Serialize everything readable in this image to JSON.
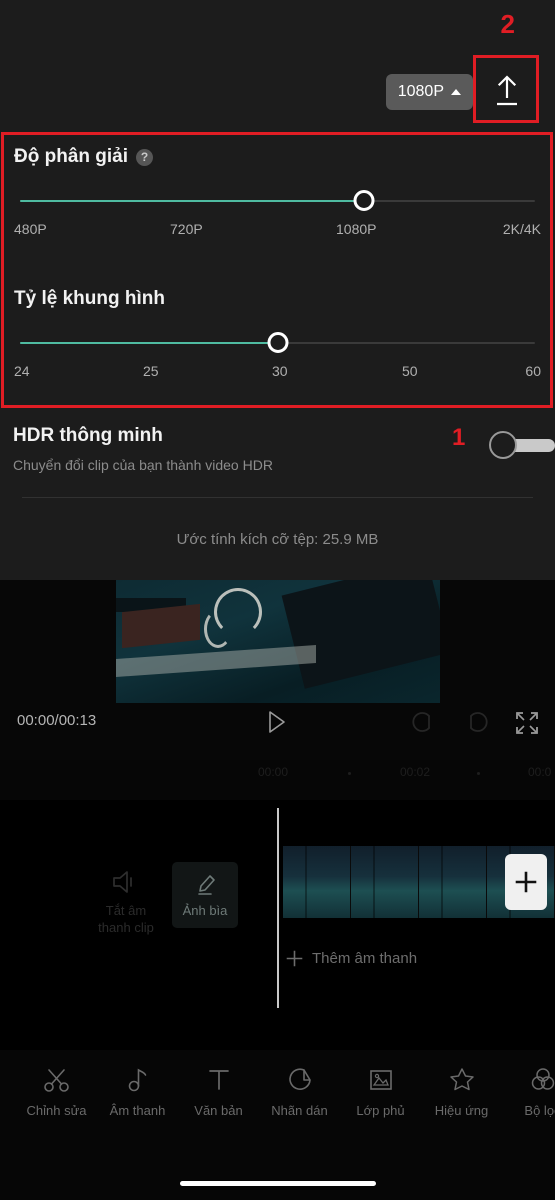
{
  "export_panel": {
    "resolution_chip": {
      "label": "1080P",
      "caret_icon": "chevron-up-icon"
    },
    "export_icon": "export-upload-icon",
    "resolution": {
      "title": "Độ phân giải",
      "help_icon": "?",
      "labels": [
        "480P",
        "720P",
        "1080P",
        "2K/4K"
      ],
      "selected": "1080P",
      "selected_index": 2
    },
    "framerate": {
      "title": "Tỷ lệ khung hình",
      "labels": [
        "24",
        "25",
        "30",
        "50",
        "60"
      ],
      "selected": "30",
      "selected_index": 2
    },
    "hdr": {
      "title": "HDR thông minh",
      "subtitle": "Chuyển đổi clip của bạn thành video HDR",
      "toggle_state": "off"
    },
    "file_size": "Ước tính kích cỡ tệp: 25.9 MB"
  },
  "annotations": {
    "marker_one": "1",
    "marker_two": "2",
    "color": "#e01d24"
  },
  "preview": {
    "time_display": "00:00/00:13",
    "play_icon": "play-icon",
    "undo_icon": "undo-icon",
    "redo_icon": "redo-icon",
    "fullscreen_icon": "fullscreen-icon"
  },
  "timeline": {
    "ruler_labels": [
      "00:00",
      "00:02",
      "00:0"
    ],
    "mute_clip_label": "Tắt âm thanh clip",
    "mute_icon": "speaker-mute-icon",
    "cover_label": "Ảnh bìa",
    "cover_icon": "pencil-icon",
    "add_audio_label": "Thêm âm thanh",
    "add_audio_icon": "plus-icon",
    "add_clip_icon": "plus-icon"
  },
  "bottom_toolbar": {
    "items": [
      {
        "label": "Chỉnh sửa",
        "icon": "scissors-icon"
      },
      {
        "label": "Âm thanh",
        "icon": "music-note-icon"
      },
      {
        "label": "Văn bản",
        "icon": "text-t-icon"
      },
      {
        "label": "Nhãn dán",
        "icon": "sticker-icon"
      },
      {
        "label": "Lớp phủ",
        "icon": "picture-overlay-icon"
      },
      {
        "label": "Hiệu ứng",
        "icon": "sparkle-star-icon"
      },
      {
        "label": "Bộ lọc",
        "icon": "filter-circles-icon"
      }
    ]
  }
}
